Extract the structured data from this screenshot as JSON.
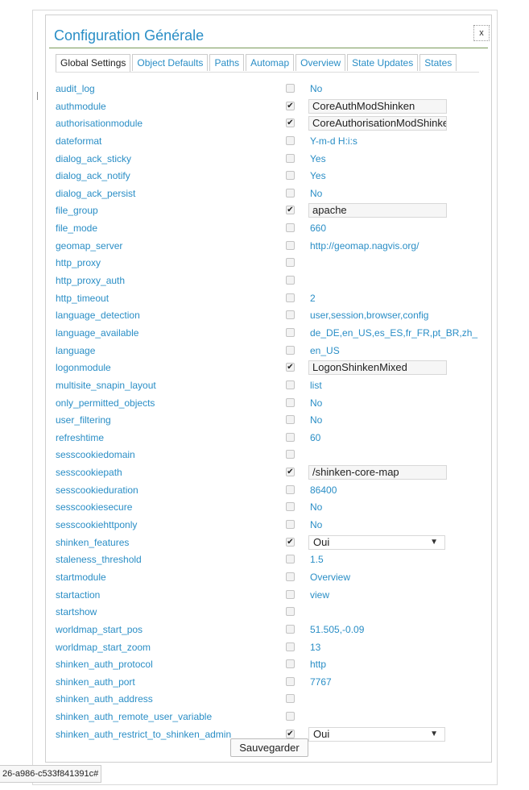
{
  "dialog": {
    "title": "Configuration Générale",
    "close_label": "x",
    "save_label": "Sauvegarder"
  },
  "tabs": [
    {
      "label": "Global Settings",
      "active": true
    },
    {
      "label": "Object Defaults",
      "active": false
    },
    {
      "label": "Paths",
      "active": false
    },
    {
      "label": "Automap",
      "active": false
    },
    {
      "label": "Overview",
      "active": false
    },
    {
      "label": "State Updates",
      "active": false
    },
    {
      "label": "States",
      "active": false
    }
  ],
  "settings": [
    {
      "key": "audit_log",
      "checked": false,
      "kind": "text",
      "value": "No"
    },
    {
      "key": "authmodule",
      "checked": true,
      "kind": "field",
      "value": "CoreAuthModShinken"
    },
    {
      "key": "authorisationmodule",
      "checked": true,
      "kind": "field",
      "value": "CoreAuthorisationModShinken"
    },
    {
      "key": "dateformat",
      "checked": false,
      "kind": "text",
      "value": "Y-m-d H:i:s"
    },
    {
      "key": "dialog_ack_sticky",
      "checked": false,
      "kind": "text",
      "value": "Yes"
    },
    {
      "key": "dialog_ack_notify",
      "checked": false,
      "kind": "text",
      "value": "Yes"
    },
    {
      "key": "dialog_ack_persist",
      "checked": false,
      "kind": "text",
      "value": "No"
    },
    {
      "key": "file_group",
      "checked": true,
      "kind": "field",
      "value": "apache"
    },
    {
      "key": "file_mode",
      "checked": false,
      "kind": "text",
      "value": "660"
    },
    {
      "key": "geomap_server",
      "checked": false,
      "kind": "text",
      "value": "http://geomap.nagvis.org/"
    },
    {
      "key": "http_proxy",
      "checked": false,
      "kind": "text",
      "value": ""
    },
    {
      "key": "http_proxy_auth",
      "checked": false,
      "kind": "text",
      "value": ""
    },
    {
      "key": "http_timeout",
      "checked": false,
      "kind": "text",
      "value": "2"
    },
    {
      "key": "language_detection",
      "checked": false,
      "kind": "text",
      "value": "user,session,browser,config"
    },
    {
      "key": "language_available",
      "checked": false,
      "kind": "text",
      "value": "de_DE,en_US,es_ES,fr_FR,pt_BR,zh_"
    },
    {
      "key": "language",
      "checked": false,
      "kind": "text",
      "value": "en_US"
    },
    {
      "key": "logonmodule",
      "checked": true,
      "kind": "field",
      "value": "LogonShinkenMixed"
    },
    {
      "key": "multisite_snapin_layout",
      "checked": false,
      "kind": "text",
      "value": "list"
    },
    {
      "key": "only_permitted_objects",
      "checked": false,
      "kind": "text",
      "value": "No"
    },
    {
      "key": "user_filtering",
      "checked": false,
      "kind": "text",
      "value": "No"
    },
    {
      "key": "refreshtime",
      "checked": false,
      "kind": "text",
      "value": "60"
    },
    {
      "key": "sesscookiedomain",
      "checked": false,
      "kind": "text",
      "value": ""
    },
    {
      "key": "sesscookiepath",
      "checked": true,
      "kind": "field",
      "value": "/shinken-core-map"
    },
    {
      "key": "sesscookieduration",
      "checked": false,
      "kind": "text",
      "value": "86400"
    },
    {
      "key": "sesscookiesecure",
      "checked": false,
      "kind": "text",
      "value": "No"
    },
    {
      "key": "sesscookiehttponly",
      "checked": false,
      "kind": "text",
      "value": "No"
    },
    {
      "key": "shinken_features",
      "checked": true,
      "kind": "select",
      "value": "Oui"
    },
    {
      "key": "staleness_threshold",
      "checked": false,
      "kind": "text",
      "value": "1.5"
    },
    {
      "key": "startmodule",
      "checked": false,
      "kind": "text",
      "value": "Overview"
    },
    {
      "key": "startaction",
      "checked": false,
      "kind": "text",
      "value": "view"
    },
    {
      "key": "startshow",
      "checked": false,
      "kind": "text",
      "value": ""
    },
    {
      "key": "worldmap_start_pos",
      "checked": false,
      "kind": "text",
      "value": "51.505,-0.09"
    },
    {
      "key": "worldmap_start_zoom",
      "checked": false,
      "kind": "text",
      "value": "13"
    },
    {
      "key": "shinken_auth_protocol",
      "checked": false,
      "kind": "text",
      "value": "http"
    },
    {
      "key": "shinken_auth_port",
      "checked": false,
      "kind": "text",
      "value": "7767"
    },
    {
      "key": "shinken_auth_address",
      "checked": false,
      "kind": "text",
      "value": ""
    },
    {
      "key": "shinken_auth_remote_user_variable",
      "checked": false,
      "kind": "text",
      "value": ""
    },
    {
      "key": "shinken_auth_restrict_to_shinken_admin",
      "checked": true,
      "kind": "select",
      "value": "Oui"
    }
  ],
  "statusbar": {
    "url_text": "26-a986-c533f841391c#"
  }
}
